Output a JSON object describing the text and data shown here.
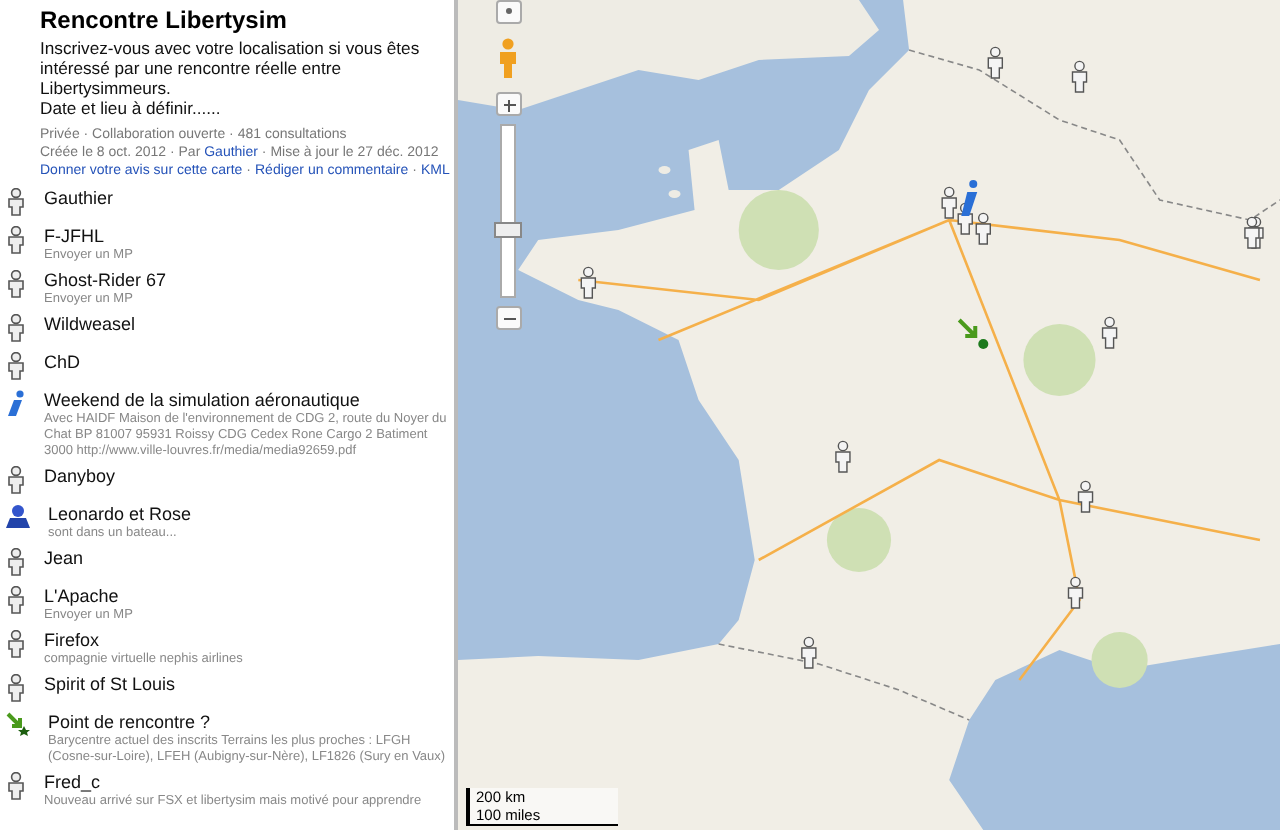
{
  "sidebar": {
    "title": "Rencontre Libertysim",
    "description": [
      "Inscrivez-vous avec votre localisation si vous êtes intéressé par une rencontre réelle entre Libertysimmeurs.",
      "Date et lieu à définir......"
    ],
    "meta": "Privée · Collaboration ouverte · 481 consultations",
    "created": "Créée le 8 oct. 2012 · Par ",
    "author": "Gauthier",
    "updated": " · Mise à jour le 27 déc. 2012",
    "links": [
      "Donner votre avis sur cette carte",
      "Rédiger un commentaire",
      "KML"
    ],
    "link_separator": "·",
    "items": [
      {
        "kind": "person",
        "name": "Gauthier"
      },
      {
        "kind": "person",
        "name": "F-JFHL",
        "note": "Envoyer un MP"
      },
      {
        "kind": "person",
        "name": "Ghost-Rider 67",
        "note": "Envoyer un MP"
      },
      {
        "kind": "person",
        "name": "Wildweasel"
      },
      {
        "kind": "person",
        "name": "ChD"
      },
      {
        "kind": "info",
        "name": "Weekend de la simulation aéronautique",
        "note": "Avec HAIDF Maison de l'environnement de CDG 2, route du Noyer du Chat BP 81007 95931 Roissy CDG Cedex Rone Cargo 2 Batiment 3000 http://www.ville-louvres.fr/media/media92659.pdf"
      },
      {
        "kind": "person",
        "name": "Danyboy"
      },
      {
        "kind": "group",
        "name": "Leonardo et Rose",
        "note": "sont dans un bateau..."
      },
      {
        "kind": "person",
        "name": "Jean"
      },
      {
        "kind": "person",
        "name": "L'Apache",
        "note": "Envoyer un MP"
      },
      {
        "kind": "person",
        "name": "Firefox",
        "note": "compagnie virtuelle nephis airlines"
      },
      {
        "kind": "person",
        "name": "Spirit of St Louis"
      },
      {
        "kind": "meeting",
        "name": "Point de rencontre ?",
        "note": "Barycentre actuel des inscrits Terrains les plus proches : LFGH (Cosne-sur-Loire), LFEH (Aubigny-sur-Nère), LF1826 (Sury en Vaux)"
      },
      {
        "kind": "person",
        "name": "Fred_c",
        "note": "Nouveau arrivé sur FSX et libertysim mais motivé pour apprendre"
      }
    ]
  },
  "map": {
    "zoom": {
      "level": 0.38
    },
    "scale": [
      "200 km",
      "100 miles"
    ]
  }
}
